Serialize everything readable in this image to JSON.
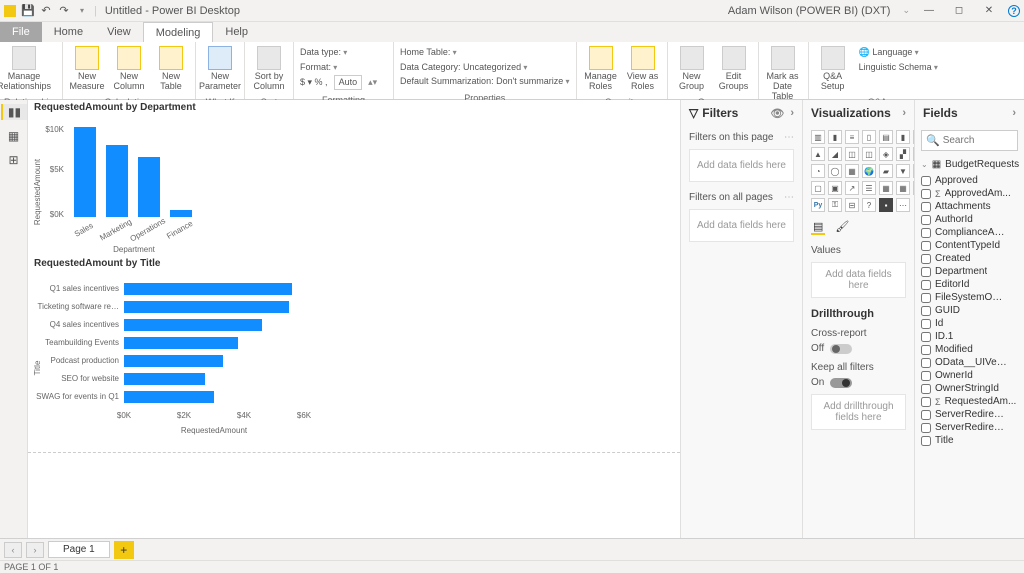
{
  "titlebar": {
    "app_title": "Untitled - Power BI Desktop",
    "user": "Adam Wilson (POWER BI) (DXT)"
  },
  "tabs": {
    "file": "File",
    "home": "Home",
    "view": "View",
    "modeling": "Modeling",
    "help": "Help"
  },
  "ribbon": {
    "relationships": {
      "manage": "Manage\nRelationships",
      "group": "Relationships"
    },
    "calculations": {
      "new_measure": "New\nMeasure",
      "new_column": "New\nColumn",
      "new_table": "New\nTable",
      "group": "Calculations"
    },
    "whatif": {
      "new_parameter": "New\nParameter",
      "group": "What If"
    },
    "sort": {
      "sort_by": "Sort by\nColumn",
      "group": "Sort"
    },
    "formatting": {
      "data_type": "Data type:",
      "format": "Format:",
      "currency": "$ ▾  %  ,",
      "auto": "Auto",
      "group": "Formatting"
    },
    "properties": {
      "home_table": "Home Table:",
      "data_category": "Data Category: Uncategorized",
      "default_sum": "Default Summarization: Don't summarize",
      "group": "Properties"
    },
    "security": {
      "manage_roles": "Manage\nRoles",
      "view_as": "View as\nRoles",
      "group": "Security"
    },
    "groups": {
      "new_group": "New\nGroup",
      "edit_groups": "Edit\nGroups",
      "group": "Groups"
    },
    "calendars": {
      "mark_date": "Mark as\nDate Table",
      "group": "Calendars"
    },
    "qa": {
      "qa_setup": "Q&A\nSetup",
      "language": "Language",
      "ling_schema": "Linguistic Schema",
      "group": "Q&A"
    }
  },
  "filters": {
    "header": "Filters",
    "on_page": "Filters on this page",
    "on_all": "Filters on all pages",
    "add_here": "Add data fields here"
  },
  "visualizations": {
    "header": "Visualizations",
    "values": "Values",
    "add_here": "Add data fields here",
    "drill_header": "Drillthrough",
    "cross_report": "Cross-report",
    "off": "Off",
    "keep_filters": "Keep all filters",
    "on": "On",
    "add_drill": "Add drillthrough fields here"
  },
  "fields": {
    "header": "Fields",
    "search_placeholder": "Search",
    "table": "BudgetRequests",
    "items": [
      {
        "name": "Approved",
        "agg": false
      },
      {
        "name": "ApprovedAm...",
        "agg": true
      },
      {
        "name": "Attachments",
        "agg": false
      },
      {
        "name": "AuthorId",
        "agg": false
      },
      {
        "name": "ComplianceAs...",
        "agg": false
      },
      {
        "name": "ContentTypeId",
        "agg": false
      },
      {
        "name": "Created",
        "agg": false
      },
      {
        "name": "Department",
        "agg": false
      },
      {
        "name": "EditorId",
        "agg": false
      },
      {
        "name": "FileSystemObj...",
        "agg": false
      },
      {
        "name": "GUID",
        "agg": false
      },
      {
        "name": "Id",
        "agg": false
      },
      {
        "name": "ID.1",
        "agg": false
      },
      {
        "name": "Modified",
        "agg": false
      },
      {
        "name": "OData__UIVer...",
        "agg": false
      },
      {
        "name": "OwnerId",
        "agg": false
      },
      {
        "name": "OwnerStringId",
        "agg": false
      },
      {
        "name": "RequestedAm...",
        "agg": true
      },
      {
        "name": "ServerRedirec...",
        "agg": false
      },
      {
        "name": "ServerRedirec...",
        "agg": false
      },
      {
        "name": "Title",
        "agg": false
      }
    ]
  },
  "pagetabs": {
    "page1": "Page 1"
  },
  "status": {
    "text": "PAGE 1 OF 1"
  },
  "chart_data": [
    {
      "type": "bar",
      "orientation": "vertical",
      "title": "RequestedAmount by Department",
      "xlabel": "Department",
      "ylabel": "RequestedAmount",
      "categories": [
        "Sales",
        "Marketing",
        "Operations",
        "Finance"
      ],
      "values": [
        12000,
        9500,
        8000,
        1000
      ],
      "ylim": [
        0,
        12000
      ],
      "yticks": [
        "$0K",
        "$5K",
        "$10K"
      ]
    },
    {
      "type": "bar",
      "orientation": "horizontal",
      "title": "RequestedAmount by Title",
      "xlabel": "RequestedAmount",
      "ylabel": "Title",
      "categories": [
        "Q1 sales incentives",
        "Ticketing software re...",
        "Q4 sales incentives",
        "Teambuilding Events",
        "Podcast production",
        "SEO for website",
        "SWAG for events in Q1"
      ],
      "values": [
        5600,
        5500,
        4600,
        3800,
        3300,
        2700,
        3000
      ],
      "xlim": [
        0,
        6000
      ],
      "xticks": [
        "$0K",
        "$2K",
        "$4K",
        "$6K"
      ]
    }
  ]
}
